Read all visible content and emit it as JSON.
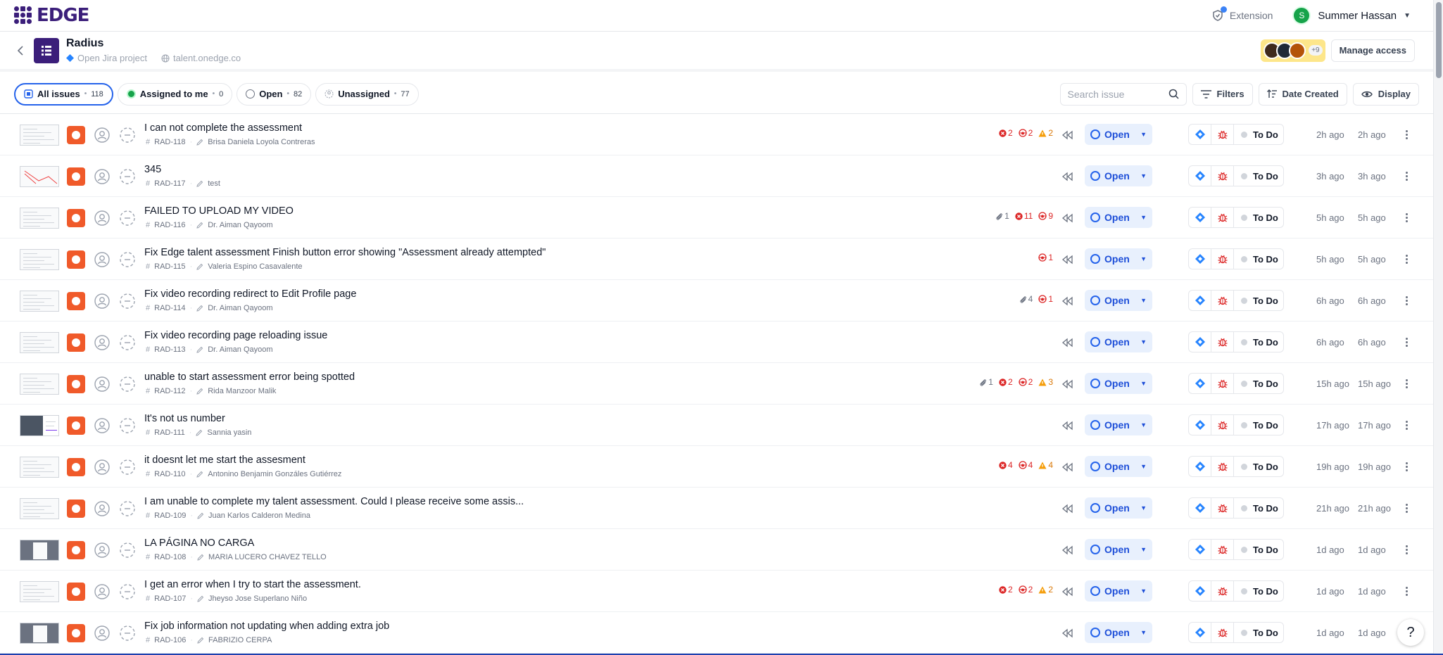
{
  "brand": {
    "name": "EDGE",
    "color": "#3b1e7a"
  },
  "topbar": {
    "extension_label": "Extension",
    "user_initial": "S",
    "user_name": "Summer Hassan"
  },
  "project": {
    "title": "Radius",
    "jira_link": "Open Jira project",
    "domain": "talent.onedge.co",
    "members_more": "+9",
    "manage_access": "Manage access"
  },
  "filters": {
    "chips": [
      {
        "label": "All issues",
        "count": "118"
      },
      {
        "label": "Assigned to me",
        "count": "0"
      },
      {
        "label": "Open",
        "count": "82"
      },
      {
        "label": "Unassigned",
        "count": "77"
      }
    ],
    "search_placeholder": "Search issue",
    "filters_label": "Filters",
    "sort_label": "Date Created",
    "display_label": "Display"
  },
  "status_label": "Open",
  "jira_status": "To Do",
  "colors": {
    "accent": "#2563eb",
    "priority": "#f05a2a",
    "error": "#dc2626",
    "warning": "#d97706"
  },
  "issues": [
    {
      "title": "I can not complete the assessment",
      "key": "RAD-118",
      "reporter": "Brisa Daniela Loyola Contreras",
      "badges": [
        [
          "x",
          "2"
        ],
        [
          "bug",
          "2"
        ],
        [
          "warn",
          "2"
        ]
      ],
      "created": "2h ago",
      "updated": "2h ago",
      "thumb": "doc"
    },
    {
      "title": "345",
      "key": "RAD-117",
      "reporter": "test",
      "badges": [],
      "created": "3h ago",
      "updated": "3h ago",
      "thumb": "chart"
    },
    {
      "title": "FAILED TO UPLOAD MY VIDEO",
      "key": "RAD-116",
      "reporter": "Dr. Aiman Qayoom",
      "badges": [
        [
          "clip",
          "1"
        ],
        [
          "x",
          "11"
        ],
        [
          "bug",
          "9"
        ]
      ],
      "created": "5h ago",
      "updated": "5h ago",
      "thumb": "doc"
    },
    {
      "title": "Fix Edge talent assessment Finish button error showing \"Assessment already attempted\"",
      "key": "RAD-115",
      "reporter": "Valeria Espino Casavalente",
      "badges": [
        [
          "bug",
          "1"
        ]
      ],
      "created": "5h ago",
      "updated": "5h ago",
      "thumb": "doc"
    },
    {
      "title": "Fix video recording redirect to Edit Profile page",
      "key": "RAD-114",
      "reporter": "Dr. Aiman Qayoom",
      "badges": [
        [
          "clip",
          "4"
        ],
        [
          "bug",
          "1"
        ]
      ],
      "created": "6h ago",
      "updated": "6h ago",
      "thumb": "doc"
    },
    {
      "title": "Fix video recording page reloading issue",
      "key": "RAD-113",
      "reporter": "Dr. Aiman Qayoom",
      "badges": [],
      "created": "6h ago",
      "updated": "6h ago",
      "thumb": "doc"
    },
    {
      "title": "unable to start assessment error being spotted",
      "key": "RAD-112",
      "reporter": "Rida Manzoor Malik",
      "badges": [
        [
          "clip",
          "1"
        ],
        [
          "x",
          "2"
        ],
        [
          "bug",
          "2"
        ],
        [
          "warn",
          "3"
        ]
      ],
      "created": "15h ago",
      "updated": "15h ago",
      "thumb": "doc"
    },
    {
      "title": "It's not us number",
      "key": "RAD-111",
      "reporter": "Sannia yasin",
      "badges": [],
      "created": "17h ago",
      "updated": "17h ago",
      "thumb": "photo"
    },
    {
      "title": "it doesnt let me start the assesment",
      "key": "RAD-110",
      "reporter": "Antonino Benjamin Gonzáles Gutiérrez",
      "badges": [
        [
          "x",
          "4"
        ],
        [
          "bug",
          "4"
        ],
        [
          "warn",
          "4"
        ]
      ],
      "created": "19h ago",
      "updated": "19h ago",
      "thumb": "doc"
    },
    {
      "title": "I am unable to complete my talent assessment. Could I please receive some assis...",
      "key": "RAD-109",
      "reporter": "Juan Karlos Calderon Medina",
      "badges": [],
      "created": "21h ago",
      "updated": "21h ago",
      "thumb": "doc"
    },
    {
      "title": "LA PÁGINA NO CARGA",
      "key": "RAD-108",
      "reporter": "MARIA LUCERO CHAVEZ TELLO",
      "badges": [],
      "created": "1d ago",
      "updated": "1d ago",
      "thumb": "dark"
    },
    {
      "title": "I get an error when I try to start the assessment.",
      "key": "RAD-107",
      "reporter": "Jheyso Jose Superlano Niño",
      "badges": [
        [
          "x",
          "2"
        ],
        [
          "bug",
          "2"
        ],
        [
          "warn",
          "2"
        ]
      ],
      "created": "1d ago",
      "updated": "1d ago",
      "thumb": "doc"
    },
    {
      "title": "Fix job information not updating when adding extra job",
      "key": "RAD-106",
      "reporter": "FABRIZIO CERPA",
      "badges": [],
      "created": "1d ago",
      "updated": "1d ago",
      "thumb": "dark"
    }
  ]
}
